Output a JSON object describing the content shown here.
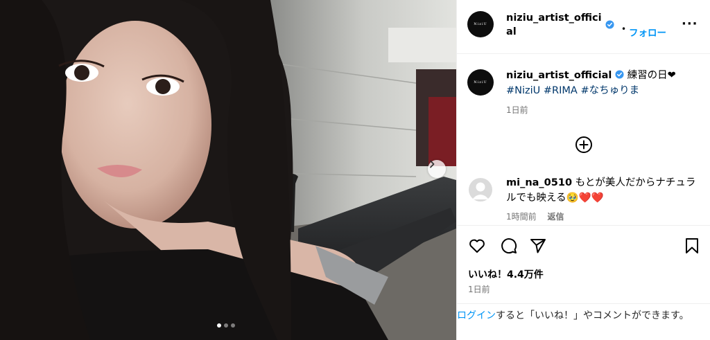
{
  "post": {
    "account": {
      "username": "niziu_artist_official",
      "avatar_logo_text": "NiziU",
      "follow_label": "フォロー",
      "separator": "•",
      "more_icon": "more-horizontal-icon"
    },
    "caption": {
      "username": "niziu_artist_official",
      "text": " 練習の日❤",
      "hashtags": [
        "#NiziU",
        "#RIMA",
        "#なちゅりま"
      ],
      "time": "1日前"
    },
    "comments": [
      {
        "username": "mi_na_0510",
        "text": " もとが美人だからナチュラルでも映える🥹❤️❤️",
        "time": "1時間前",
        "reply_label": "返信"
      }
    ],
    "likes": "いいね！4.4万件",
    "time": "1日前",
    "carousel": {
      "total": 3,
      "current": 1
    },
    "icons": [
      "heart-icon",
      "comment-icon",
      "share-icon",
      "bookmark-icon",
      "add-circle-icon",
      "chevron-right-icon",
      "verified-icon"
    ]
  },
  "login_prompt": {
    "link": "ログイン",
    "text": "すると「いいね！」やコメントができます。"
  },
  "colors": {
    "accent": "#0095f6",
    "hashtag": "#00376b",
    "verified": "#3897f0",
    "muted": "#737373"
  }
}
